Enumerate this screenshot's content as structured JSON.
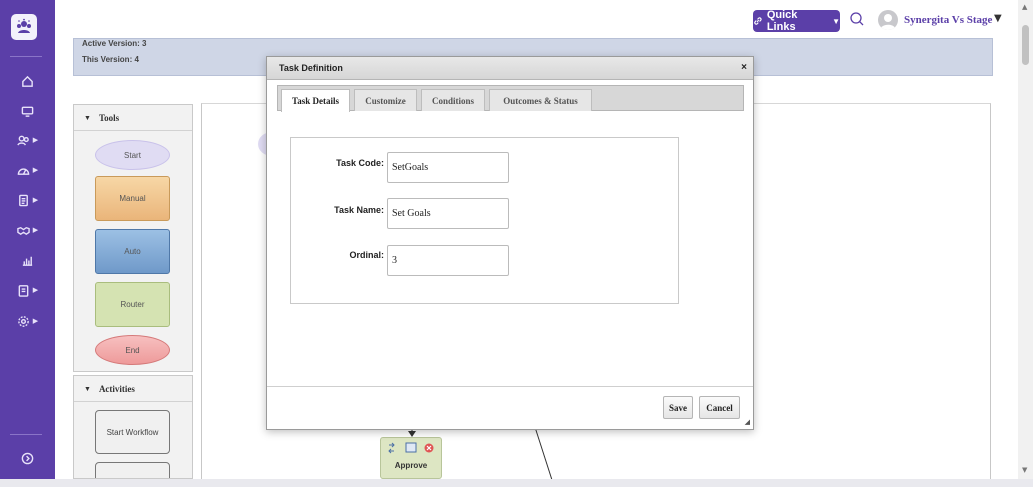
{
  "topbar": {
    "quick_links_label": "Quick Links",
    "user_name": "Synergita Vs Stage"
  },
  "version_info": {
    "active_version": "Active Version: 3",
    "this_version": "This Version: 4"
  },
  "tools_panel": {
    "title": "Tools",
    "shapes": [
      "Start",
      "Manual",
      "Auto",
      "Router",
      "End"
    ]
  },
  "activities_panel": {
    "title": "Activities",
    "items": [
      "Start Workflow"
    ]
  },
  "canvas": {
    "approve_node_label": "Approve"
  },
  "modal": {
    "title": "Task Definition",
    "close_label": "×",
    "tabs": [
      {
        "label": "Task Details",
        "active": true
      },
      {
        "label": "Customize",
        "active": false
      },
      {
        "label": "Conditions",
        "active": false
      },
      {
        "label": "Outcomes & Status",
        "active": false
      }
    ],
    "fields": {
      "task_code_label": "Task Code:",
      "task_code_value": "SetGoals",
      "task_name_label": "Task Name:",
      "task_name_value": "Set Goals",
      "ordinal_label": "Ordinal:",
      "ordinal_value": "3"
    },
    "save_label": "Save",
    "cancel_label": "Cancel"
  },
  "colors": {
    "sidebar": "#5b3fa8",
    "accent": "#5b3fa8",
    "manual_shape": "#f3c78c",
    "auto_shape": "#7fa6d1",
    "router_shape": "#d5e3b2",
    "end_shape": "#f2a6a6",
    "start_shape": "#e0dcf3"
  }
}
